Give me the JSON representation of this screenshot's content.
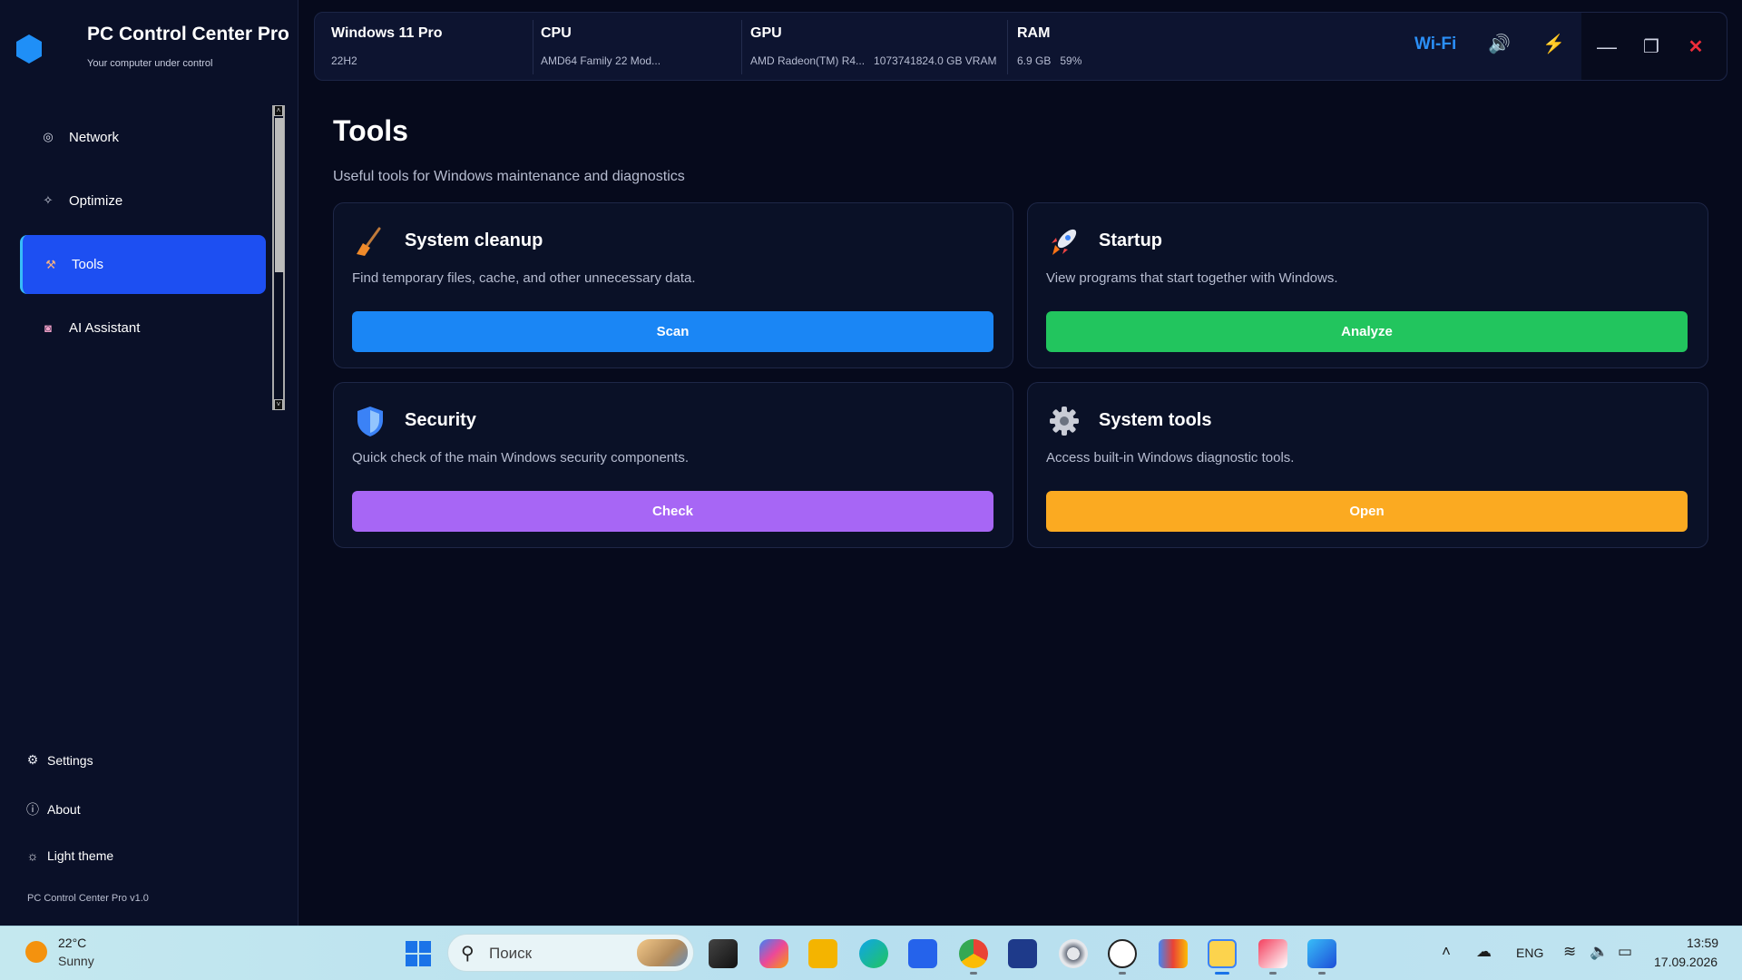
{
  "colors": {
    "accent": "#1d4ff2",
    "scan": "#1a86f5",
    "analyze": "#22c55e",
    "check": "#a766f5",
    "open": "#fbaa21",
    "wifi": "#2b8ff7",
    "close": "#ef2d3a"
  },
  "app": {
    "title": "PC Control Center Pro",
    "subtitle": "Your computer under control",
    "version": "PC Control Center Pro v1.0"
  },
  "sidebar": {
    "items": [
      {
        "label": "Network",
        "icon": "network-icon"
      },
      {
        "label": "Optimize",
        "icon": "optimize-icon"
      },
      {
        "label": "Tools",
        "icon": "tools-icon",
        "active": true
      },
      {
        "label": "AI Assistant",
        "icon": "robot-icon"
      }
    ],
    "bottom": [
      {
        "label": "Settings",
        "icon": "gear-icon"
      },
      {
        "label": "About",
        "icon": "info-icon"
      },
      {
        "label": "Light theme",
        "icon": "sun-icon"
      }
    ]
  },
  "sysinfo": {
    "os": {
      "label": "Windows 11 Pro",
      "value": "22H2"
    },
    "cpu": {
      "label": "CPU",
      "value": "AMD64 Family 22 Mod..."
    },
    "gpu": {
      "label": "GPU",
      "value": "AMD Radeon(TM) R4...   1073741824.0 GB VRAM"
    },
    "ram": {
      "label": "RAM",
      "value": "6.9 GB   59%"
    },
    "wifi": "Wi-Fi"
  },
  "page": {
    "title": "Tools",
    "subtitle": "Useful tools for Windows maintenance and diagnostics"
  },
  "cards": [
    {
      "title": "System cleanup",
      "desc": "Find temporary files, cache, and other unnecessary data.",
      "button": "Scan",
      "icon": "broom-icon"
    },
    {
      "title": "Startup",
      "desc": "View programs that start together with Windows.",
      "button": "Analyze",
      "icon": "rocket-icon"
    },
    {
      "title": "Security",
      "desc": "Quick check of the main Windows security components.",
      "button": "Check",
      "icon": "shield-icon"
    },
    {
      "title": "System tools",
      "desc": "Access built-in Windows diagnostic tools.",
      "button": "Open",
      "icon": "gear-icon"
    }
  ],
  "taskbar": {
    "weather_temp": "22°C",
    "weather_desc": "Sunny",
    "search_placeholder": "Поиск",
    "lang": "ENG",
    "time": "13:59",
    "date": "17.09.2026"
  }
}
